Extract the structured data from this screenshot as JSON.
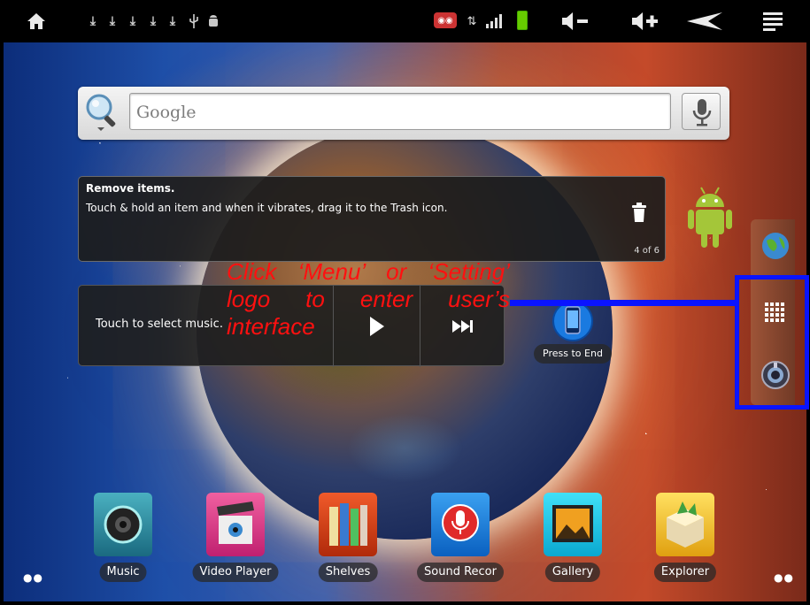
{
  "search": {
    "placeholder": "Google"
  },
  "tip": {
    "title": "Remove items.",
    "body": "Touch & hold an item and when it vibrates, drag it to the Trash icon.",
    "counter": "4 of 6"
  },
  "music_widget": {
    "prompt": "Touch to select music."
  },
  "press_to_end": {
    "label": "Press to End"
  },
  "annotation": {
    "text": "Click ‘Menu’ or ‘Setting’ logo to enter user’s interface",
    "color": "#ff1010",
    "box_color": "#0a14ff"
  },
  "dock": [
    {
      "label": "Music",
      "icon": "speaker-icon",
      "color": "#3a8ea0"
    },
    {
      "label": "Video Player",
      "icon": "clapperboard-icon",
      "color": "#e0408a"
    },
    {
      "label": "Shelves",
      "icon": "books-icon",
      "color": "#e03a1a"
    },
    {
      "label": "Sound Recor",
      "icon": "microphone-icon",
      "color": "#1a8ae0"
    },
    {
      "label": "Gallery",
      "icon": "picture-icon",
      "color": "#19c3e0"
    },
    {
      "label": "Explorer",
      "icon": "package-icon",
      "color": "#f0c030"
    }
  ]
}
